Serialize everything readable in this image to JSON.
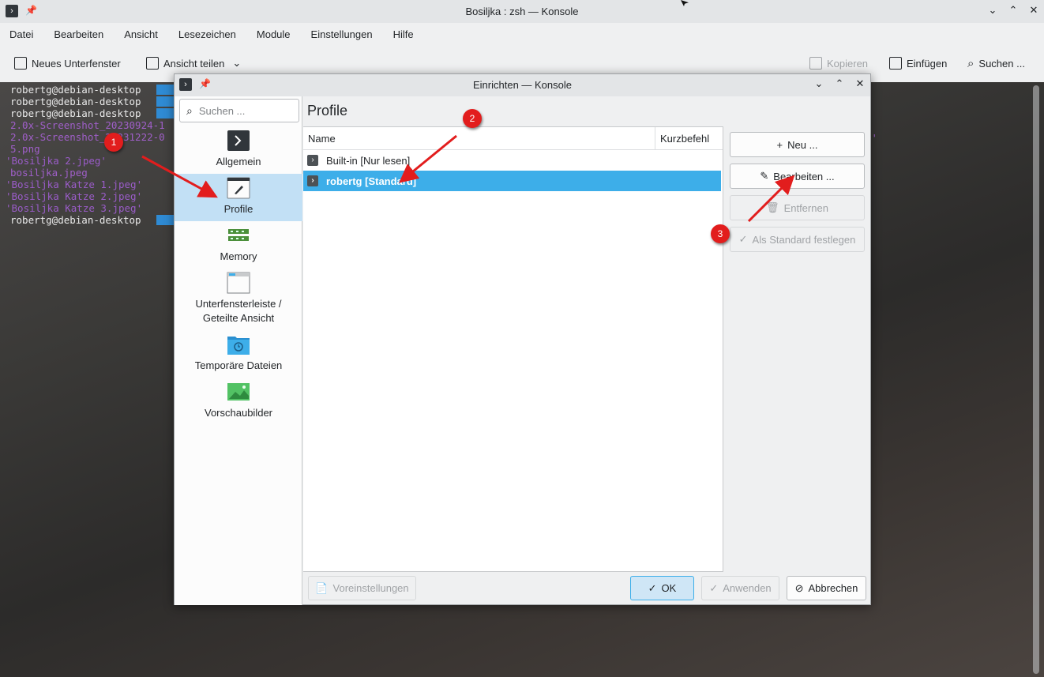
{
  "window": {
    "title": "Bosiljka : zsh — Konsole",
    "controls": [
      "⌄",
      "⌃",
      "✕"
    ]
  },
  "menubar": [
    "Datei",
    "Bearbeiten",
    "Ansicht",
    "Lesezeichen",
    "Module",
    "Einstellungen",
    "Hilfe"
  ],
  "toolbar": {
    "new_tab": "Neues Unterfenster",
    "split_view": "Ansicht teilen",
    "copy": "Kopieren",
    "paste": "Einfügen",
    "search": "Suchen ..."
  },
  "terminal": {
    "lines": [
      {
        "text": "robertg@debian-desktop",
        "kind": "prompt"
      },
      {
        "text": "robertg@debian-desktop",
        "kind": "prompt"
      },
      {
        "text": "robertg@debian-desktop",
        "kind": "prompt"
      },
      {
        "text": "2.0x-Screenshot_20230924-1",
        "kind": "file"
      },
      {
        "text": "2.0x-Screenshot_20231222-0",
        "kind": "file"
      },
      {
        "text": "5.png",
        "kind": "file"
      },
      {
        "text": "'Bosiljka 2.jpeg'",
        "kind": "quoted"
      },
      {
        "text": "bosiljka.jpeg",
        "kind": "file"
      },
      {
        "text": "'Bosiljka Katze 1.jpeg'",
        "kind": "quoted"
      },
      {
        "text": "'Bosiljka Katze 2.jpeg'",
        "kind": "quoted"
      },
      {
        "text": "'Bosiljka Katze 3.jpeg'",
        "kind": "quoted"
      },
      {
        "text": "robertg@debian-desktop",
        "kind": "prompt"
      }
    ],
    "right_fragment": "g'"
  },
  "dialog": {
    "title": "Einrichten — Konsole",
    "search_placeholder": "Suchen ...",
    "sidebar": [
      {
        "label": "Allgemein",
        "icon": "terminal-icon"
      },
      {
        "label": "Profile",
        "icon": "profile-edit-icon",
        "selected": true
      },
      {
        "label": "Memory",
        "icon": "memory-icon"
      },
      {
        "label": "Unterfensterleiste /\nGeteilte Ansicht",
        "icon": "tabbar-icon"
      },
      {
        "label": "Temporäre Dateien",
        "icon": "temp-folder-icon"
      },
      {
        "label": "Vorschaubilder",
        "icon": "thumbnail-icon"
      }
    ],
    "page_title": "Profile",
    "table": {
      "columns": [
        "Name",
        "Kurzbefehl"
      ],
      "rows": [
        {
          "name": "Built-in [Nur lesen]",
          "selected": false
        },
        {
          "name": "robertg [Standard]",
          "selected": true
        }
      ]
    },
    "buttons": {
      "new": "Neu ...",
      "edit": "Bearbeiten ...",
      "remove": "Entfernen",
      "set_default": "Als Standard festlegen"
    },
    "footer": {
      "defaults": "Voreinstellungen",
      "ok": "OK",
      "apply": "Anwenden",
      "cancel": "Abbrechen"
    }
  },
  "annotations": [
    "1",
    "2",
    "3"
  ],
  "colors": {
    "accent": "#3daee9",
    "annotation": "#e21d1d",
    "terminal_file": "#a05fc9"
  }
}
